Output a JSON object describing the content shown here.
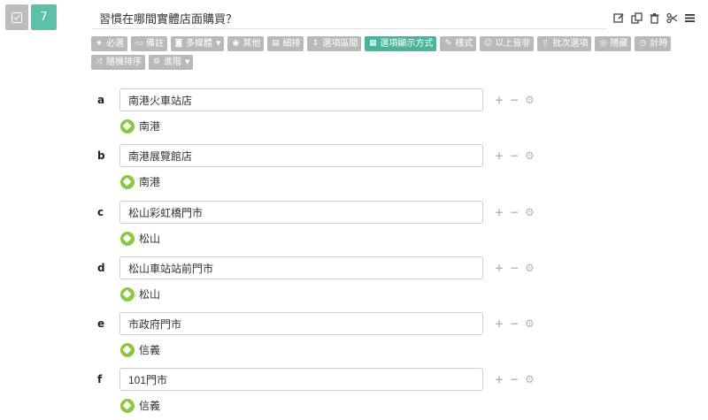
{
  "question": {
    "number": "7",
    "title": "習慣在哪間實體店面購買？"
  },
  "icons": {
    "type": "checkbox-icon",
    "edit": "edit-icon",
    "copy": "copy-icon",
    "delete": "trash-icon",
    "cut": "scissors-icon",
    "menu": "menu-icon",
    "tag": "tag-icon"
  },
  "colors": {
    "accent": "#47b59b",
    "number_badge": "#5cbfa8",
    "toolbar_button": "#b9b9b9",
    "tag": "#8dc63f"
  },
  "toolbar": {
    "required": "必選",
    "note": "備註",
    "media": "多媒體",
    "other": "其他",
    "layout": "細排",
    "range": "選項區間",
    "display": "選項顯示方式",
    "style": "樣式",
    "none_above": "以上皆非",
    "batch": "批次選項",
    "hide": "隱藏",
    "timer": "計時",
    "shuffle": "隨機排序",
    "advanced": "進階"
  },
  "options": [
    {
      "letter": "a",
      "value": "南港火車站店",
      "tag": "南港"
    },
    {
      "letter": "b",
      "value": "南港展覽館店",
      "tag": "南港"
    },
    {
      "letter": "c",
      "value": "松山彩虹橋門市",
      "tag": "松山"
    },
    {
      "letter": "d",
      "value": "松山車站站前門市",
      "tag": "松山"
    },
    {
      "letter": "e",
      "value": "市政府門市",
      "tag": "信義"
    },
    {
      "letter": "f",
      "value": "101門市",
      "tag": "信義"
    }
  ],
  "controls": {
    "add": "+",
    "remove": "−",
    "settings": "⚙"
  }
}
